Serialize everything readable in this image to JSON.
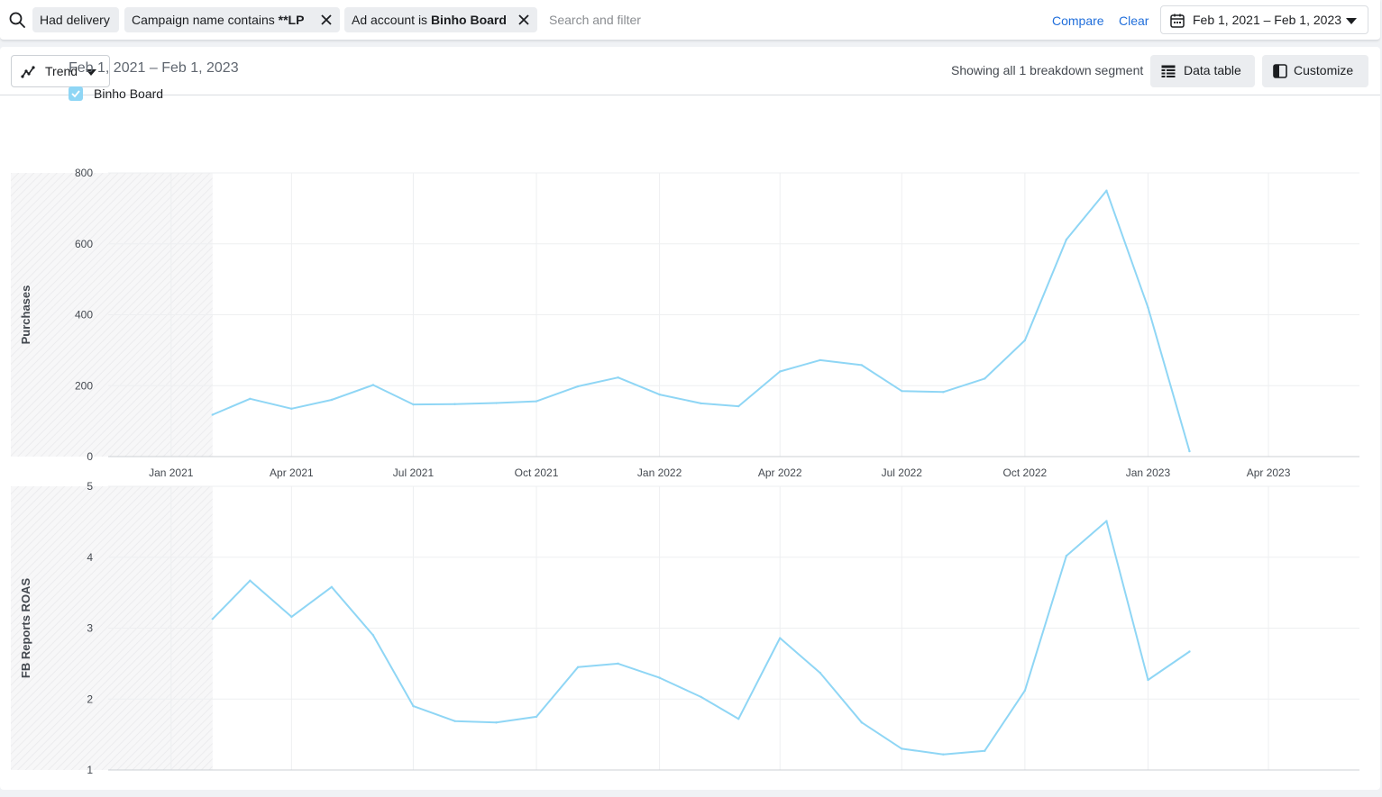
{
  "filters": {
    "search_placeholder": "Search and filter",
    "chips": [
      {
        "label": "Had delivery"
      },
      {
        "label": "Campaign name contains **LP"
      },
      {
        "label": "Ad account is Binho Board"
      }
    ],
    "compare_label": "Compare",
    "clear_label": "Clear",
    "date_range": "Feb 1, 2021 – Feb 1, 2023"
  },
  "toolbar": {
    "view_label": "Trend",
    "segments_text": "Showing all 1 breakdown segment",
    "data_table_label": "Data table",
    "customize_label": "Customize"
  },
  "chart_header": {
    "date_range": "Feb 1, 2021 – Feb 1, 2023",
    "legend_label": "Binho Board"
  },
  "colors": {
    "series": "#8fd6f5",
    "link": "#216fdb"
  },
  "chart_data": [
    {
      "type": "line",
      "ylabel": "Purchases",
      "ylim": [
        0,
        800
      ],
      "yticks": [
        0,
        200,
        400,
        600,
        800
      ],
      "xticks": [
        "Jan 2021",
        "Apr 2021",
        "Jul 2021",
        "Oct 2021",
        "Jan 2022",
        "Apr 2022",
        "Jul 2022",
        "Oct 2022",
        "Jan 2023",
        "Apr 2023"
      ],
      "x": [
        "2021-02",
        "2021-03",
        "2021-04",
        "2021-05",
        "2021-06",
        "2021-07",
        "2021-08",
        "2021-09",
        "2021-10",
        "2021-11",
        "2021-12",
        "2022-01",
        "2022-02",
        "2022-03",
        "2022-04",
        "2022-05",
        "2022-06",
        "2022-07",
        "2022-08",
        "2022-09",
        "2022-10",
        "2022-11",
        "2022-12",
        "2023-01",
        "2023-02"
      ],
      "series": [
        {
          "name": "Binho Board",
          "values": [
            118,
            163,
            135,
            160,
            202,
            147,
            148,
            151,
            156,
            198,
            223,
            175,
            150,
            142,
            240,
            272,
            258,
            185,
            182,
            220,
            328,
            612,
            750,
            420,
            15
          ]
        }
      ]
    },
    {
      "type": "line",
      "ylabel": "FB Reports ROAS",
      "ylim": [
        1,
        5
      ],
      "yticks": [
        1,
        2,
        3,
        4,
        5
      ],
      "x": [
        "2021-02",
        "2021-03",
        "2021-04",
        "2021-05",
        "2021-06",
        "2021-07",
        "2021-08",
        "2021-09",
        "2021-10",
        "2021-11",
        "2021-12",
        "2022-01",
        "2022-02",
        "2022-03",
        "2022-04",
        "2022-05",
        "2022-06",
        "2022-07",
        "2022-08",
        "2022-09",
        "2022-10",
        "2022-11",
        "2022-12",
        "2023-01",
        "2023-02"
      ],
      "series": [
        {
          "name": "Binho Board",
          "values": [
            3.13,
            3.67,
            3.16,
            3.58,
            2.9,
            1.9,
            1.69,
            1.67,
            1.75,
            2.45,
            2.5,
            2.3,
            2.03,
            1.72,
            2.86,
            2.37,
            1.67,
            1.3,
            1.22,
            1.27,
            2.12,
            4.02,
            4.51,
            2.27,
            2.67
          ]
        }
      ]
    }
  ]
}
